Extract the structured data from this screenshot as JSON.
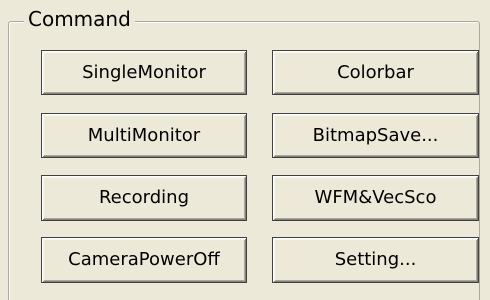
{
  "command_group": {
    "title": "Command",
    "buttons": {
      "single_monitor": "SingleMonitor",
      "colorbar": "Colorbar",
      "multi_monitor": "MultiMonitor",
      "bitmap_save": "BitmapSave...",
      "recording": "Recording",
      "wfm_vecsco": "WFM&VecSco",
      "camera_power_off": "CameraPowerOff",
      "setting": "Setting..."
    }
  },
  "colors": {
    "face": "#ece9d8",
    "frame_shadow": "#aca899",
    "button_border": "#404040",
    "text": "#000000"
  }
}
